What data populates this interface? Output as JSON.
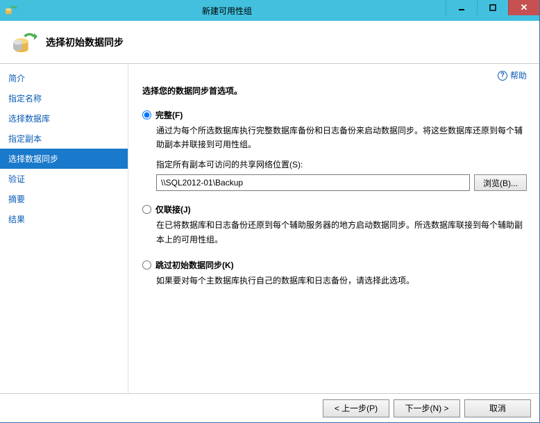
{
  "titlebar": {
    "title": "新建可用性组"
  },
  "header": {
    "title": "选择初始数据同步"
  },
  "help": {
    "label": "帮助"
  },
  "sidebar": {
    "items": [
      {
        "label": "简介",
        "active": false
      },
      {
        "label": "指定名称",
        "active": false
      },
      {
        "label": "选择数据库",
        "active": false
      },
      {
        "label": "指定副本",
        "active": false
      },
      {
        "label": "选择数据同步",
        "active": true
      },
      {
        "label": "验证",
        "active": false
      },
      {
        "label": "摘要",
        "active": false
      },
      {
        "label": "结果",
        "active": false
      }
    ]
  },
  "content": {
    "instruction": "选择您的数据同步首选项。",
    "full": {
      "label": "完整(F)",
      "desc": "通过为每个所选数据库执行完整数据库备份和日志备份来启动数据同步。将这些数据库还原到每个辅助副本并联接到可用性组。",
      "path_label": "指定所有副本可访问的共享网络位置(S):",
      "path_value": "\\\\SQL2012-01\\Backup",
      "browse": "浏览(B)..."
    },
    "join": {
      "label": "仅联接(J)",
      "desc": "在已将数据库和日志备份还原到每个辅助服务器的地方启动数据同步。所选数据库联接到每个辅助副本上的可用性组。"
    },
    "skip": {
      "label": "跳过初始数据同步(K)",
      "desc": "如果要对每个主数据库执行自己的数据库和日志备份，请选择此选项。"
    }
  },
  "footer": {
    "prev": "< 上一步(P)",
    "next": "下一步(N) >",
    "cancel": "取消"
  }
}
